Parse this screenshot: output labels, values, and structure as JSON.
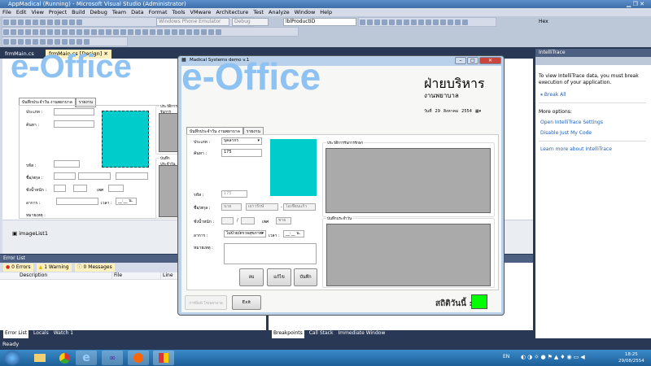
{
  "window": {
    "title": "AppMadical (Running) - Microsoft Visual Studio (Administrator)"
  },
  "menu": [
    "File",
    "Edit",
    "View",
    "Project",
    "Build",
    "Debug",
    "Team",
    "Data",
    "Format",
    "Tools",
    "VMware",
    "Architecture",
    "Test",
    "Analyze",
    "Window",
    "Help"
  ],
  "toolbar": {
    "emulator": "Windows Phone Emulator",
    "config": "Debug",
    "find": "lblProductID",
    "hex": "Hex"
  },
  "doc_tabs": [
    {
      "label": "frmMain.cs"
    },
    {
      "label": "frmMain.cs [Design]"
    }
  ],
  "designer": {
    "logo": "e-Office",
    "tab1": "บันทึกประจำวัน งานพยาบาล",
    "tab2": "รายงาน",
    "lbl_type": "ประเภท :",
    "lbl_search": "ค้นหา :",
    "lbl_id": "รหัส :",
    "lbl_name": "ชื่อ/สกุล :",
    "lbl_weight": "ชั่งน้ำหนัก :",
    "lbl_sex": "เพศ",
    "lbl_symptom": "อาการ :",
    "lbl_time": "เวลา :",
    "time_value": "__:__ น.",
    "lbl_note": "หมายเหตุ :",
    "group1": "ประวัติการรับการรักษา",
    "group2": "บันทึกประจำวัน",
    "component": "imageList1"
  },
  "app": {
    "title": "Madical Systems  demo v.1",
    "logo": "e-Office",
    "heading": "ฝ่ายบริหาร",
    "subheading": "งานพยาบาล",
    "date_label": "วันที่",
    "date_day": "29",
    "date_month": "สิงหาคม",
    "date_year": "2554",
    "tab1": "บันทึกประจำวัน งานพยาบาล",
    "tab2": "รายงาน",
    "lbl_type": "ประเภท :",
    "type_value": "บุคลากร",
    "lbl_search": "ค้นหา :",
    "search_value": "175",
    "lbl_id": "รหัส :",
    "id_value": "175",
    "lbl_name": "ชื่อ/สกุล :",
    "prefix": "นาย",
    "first_name": "เยาวรักษ์",
    "last_name": "โอเชียนแก้ว",
    "lbl_weight": "ชั่งน้ำหนัก :",
    "lbl_sex": "เพศ",
    "sex_value": "ชาย",
    "lbl_symptom": "อาการ :",
    "symptom_value": "ไม่ป่วย/ตรวจสุขภาพ",
    "lbl_time": "เวลา :",
    "time_value": "__:__ น.",
    "lbl_note": "หมายเหตุ :",
    "btn_delete": "ลบ",
    "btn_edit": "แก้ไข",
    "btn_save": "บันทึก",
    "group1": "ประวัติการรับการรักษา",
    "group2": "บันทึกประจำวัน",
    "btn_print": "การพิมพ์ โรงพยาบาล",
    "btn_exit": "Exit",
    "stats_label": "สถิติวันนี้ :",
    "status_color": "#00ff00",
    "photo_color": "#00cccc"
  },
  "error_list": {
    "title": "Error List",
    "errors": "0 Errors",
    "warnings": "1 Warning",
    "messages": "0 Messages",
    "columns": [
      "Description",
      "File",
      "Line"
    ],
    "tabs": [
      "Error List",
      "Locals",
      "Watch 1"
    ]
  },
  "debug_tabs": [
    "Breakpoints",
    "Call Stack",
    "Immediate Window"
  ],
  "intellitrace": {
    "title": "IntelliTrace",
    "message": "To view IntelliTrace data, you must break execution of your application.",
    "break_all": "Break All",
    "more_options": "More options:",
    "open_settings": "Open IntelliTrace Settings",
    "disable_jmc": "Disable Just My Code",
    "learn_more": "Learn more about IntelliTrace"
  },
  "status": {
    "text": "Ready"
  },
  "taskbar": {
    "lang": "EN",
    "time": "18:25",
    "date": "29/08/2554"
  }
}
